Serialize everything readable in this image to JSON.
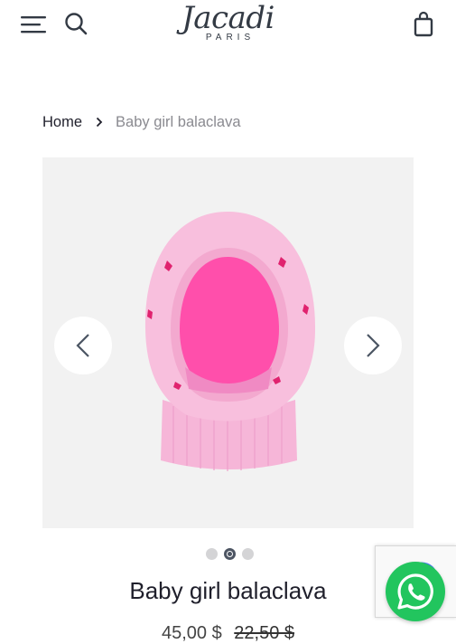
{
  "header": {
    "logo_word": "Jacadi",
    "logo_sub": "PARIS"
  },
  "breadcrumb": {
    "home": "Home",
    "current": "Baby girl balaclava"
  },
  "gallery": {
    "slide_count": 3,
    "active_slide": 2
  },
  "product": {
    "title": "Baby girl balaclava",
    "price_current": "45,00 $",
    "price_old": "22,50 $"
  },
  "colors": {
    "brand_text": "#333a44",
    "gallery_bg": "#f2f2f2",
    "whatsapp": "#22c55e"
  }
}
